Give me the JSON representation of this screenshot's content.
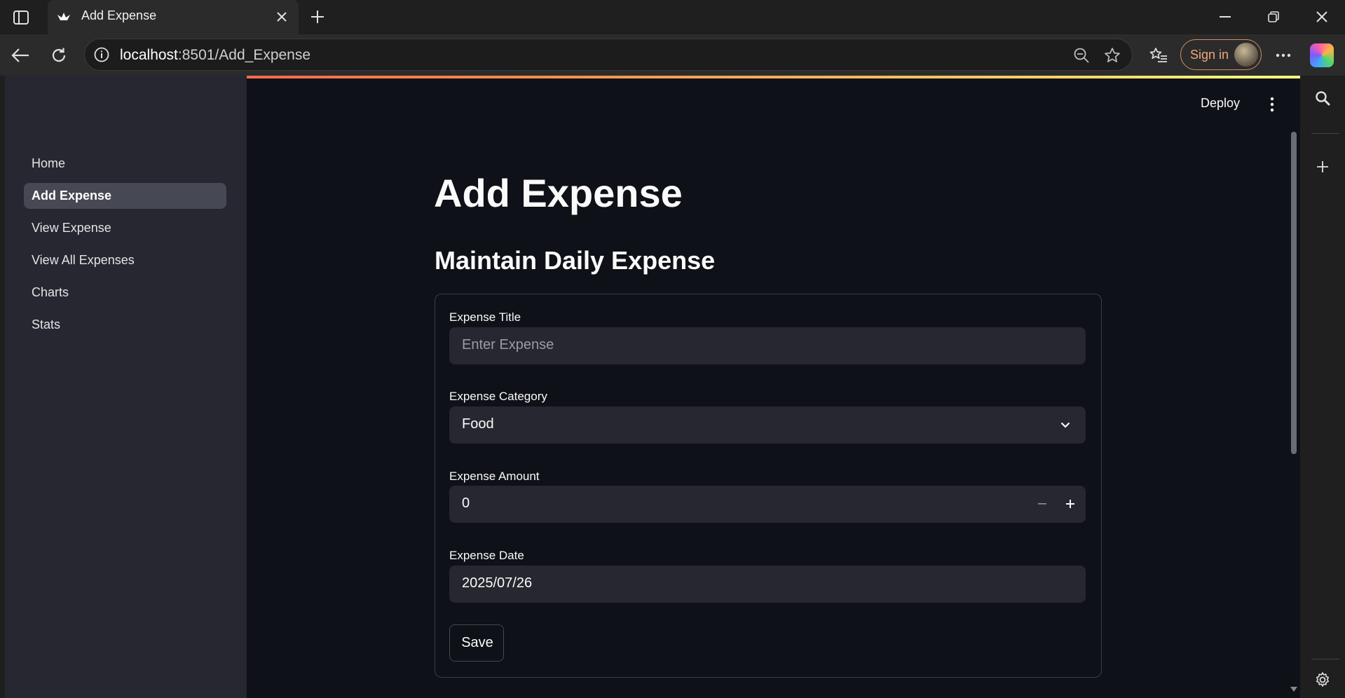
{
  "browser": {
    "tab_title": "Add Expense",
    "address_host": "localhost",
    "address_rest": ":8501/Add_Expense",
    "sign_in_label": "Sign in",
    "icons": [
      "sidebar-toggle-icon",
      "app-favicon-icon",
      "close-icon",
      "plus-icon",
      "minimize-icon",
      "restore-icon",
      "back-icon",
      "reload-icon",
      "info-icon",
      "zoom-out-icon",
      "star-icon",
      "favorites-icon",
      "more-icon",
      "copilot-icon",
      "search-icon",
      "gear-icon"
    ]
  },
  "app": {
    "deploy_label": "Deploy",
    "sidebar": {
      "items": [
        {
          "label": "Home",
          "active": false
        },
        {
          "label": "Add Expense",
          "active": true
        },
        {
          "label": "View Expense",
          "active": false
        },
        {
          "label": "View All Expenses",
          "active": false
        },
        {
          "label": "Charts",
          "active": false
        },
        {
          "label": "Stats",
          "active": false
        }
      ]
    },
    "title": "Add Expense",
    "subtitle": "Maintain Daily Expense",
    "form": {
      "title_label": "Expense Title",
      "title_placeholder": "Enter Expense",
      "category_label": "Expense Category",
      "category_value": "Food",
      "amount_label": "Expense Amount",
      "amount_value": "0",
      "date_label": "Expense Date",
      "date_value": "2025/07/26",
      "save_label": "Save"
    }
  },
  "colors": {
    "page_bg": "#0e1117",
    "sidebar_bg": "#262730",
    "input_bg": "#262730",
    "accent_orange": "#f2a679"
  }
}
